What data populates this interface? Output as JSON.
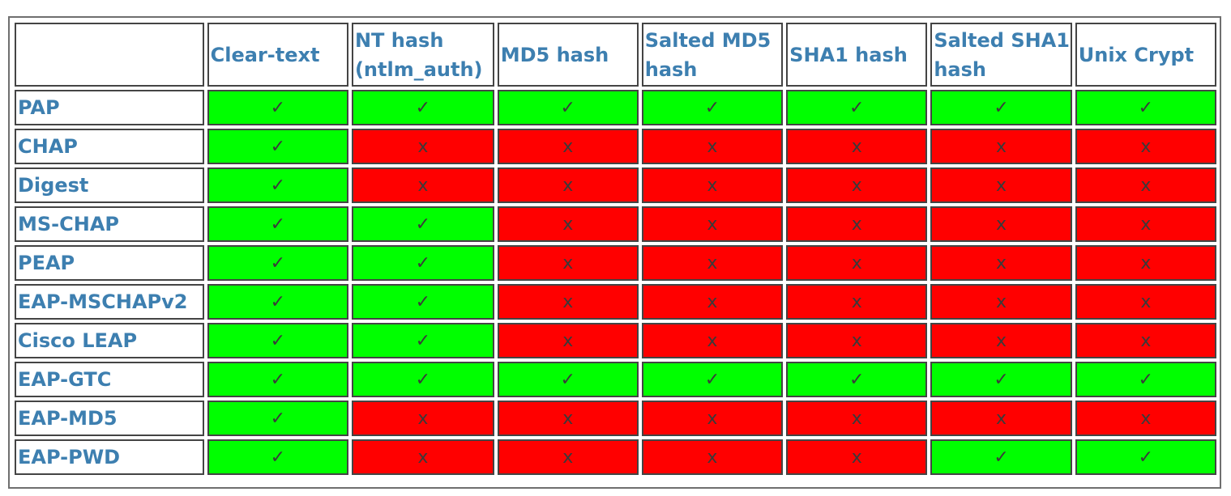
{
  "colors": {
    "supported": "#00ff00",
    "unsupported": "#ff0000",
    "label_text": "#3d7fb0"
  },
  "marks": {
    "yes": "✓",
    "no": "x"
  },
  "columns": [
    "Clear-text",
    "NT hash (ntlm_auth)",
    "MD5 hash",
    "Salted MD5 hash",
    "SHA1 hash",
    "Salted SHA1 hash",
    "Unix Crypt"
  ],
  "rows": [
    {
      "label": "PAP",
      "support": [
        true,
        true,
        true,
        true,
        true,
        true,
        true
      ]
    },
    {
      "label": "CHAP",
      "support": [
        true,
        false,
        false,
        false,
        false,
        false,
        false
      ]
    },
    {
      "label": "Digest",
      "support": [
        true,
        false,
        false,
        false,
        false,
        false,
        false
      ]
    },
    {
      "label": "MS-CHAP",
      "support": [
        true,
        true,
        false,
        false,
        false,
        false,
        false
      ]
    },
    {
      "label": "PEAP",
      "support": [
        true,
        true,
        false,
        false,
        false,
        false,
        false
      ]
    },
    {
      "label": "EAP-MSCHAPv2",
      "support": [
        true,
        true,
        false,
        false,
        false,
        false,
        false
      ]
    },
    {
      "label": "Cisco LEAP",
      "support": [
        true,
        true,
        false,
        false,
        false,
        false,
        false
      ]
    },
    {
      "label": "EAP-GTC",
      "support": [
        true,
        true,
        true,
        true,
        true,
        true,
        true
      ]
    },
    {
      "label": "EAP-MD5",
      "support": [
        true,
        false,
        false,
        false,
        false,
        false,
        false
      ]
    },
    {
      "label": "EAP-PWD",
      "support": [
        true,
        false,
        false,
        false,
        false,
        true,
        true
      ]
    }
  ]
}
